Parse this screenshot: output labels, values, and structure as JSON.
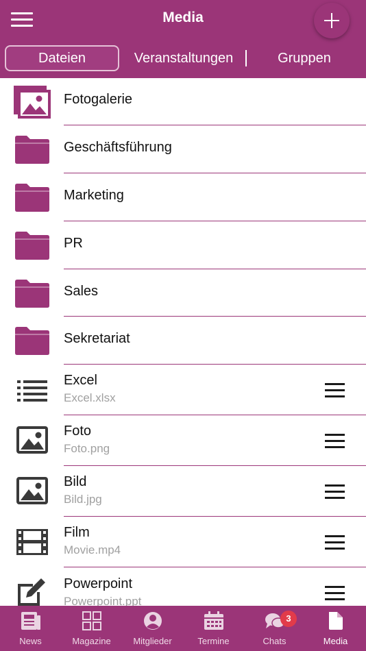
{
  "header": {
    "title": "Media"
  },
  "tabs": {
    "files": "Dateien",
    "events": "Veranstaltungen",
    "groups": "Gruppen"
  },
  "folders": [
    {
      "label": "Fotogalerie",
      "icon": "photo-gallery-icon"
    },
    {
      "label": "Geschäftsführung",
      "icon": "folder-icon"
    },
    {
      "label": "Marketing",
      "icon": "folder-icon"
    },
    {
      "label": "PR",
      "icon": "folder-icon"
    },
    {
      "label": "Sales",
      "icon": "folder-icon"
    },
    {
      "label": "Sekretariat",
      "icon": "folder-icon"
    }
  ],
  "files": [
    {
      "title": "Excel",
      "filename": "Excel.xlsx",
      "icon": "list-icon"
    },
    {
      "title": "Foto",
      "filename": "Foto.png",
      "icon": "image-icon"
    },
    {
      "title": "Bild",
      "filename": "Bild.jpg",
      "icon": "image-icon"
    },
    {
      "title": "Film",
      "filename": "Movie.mp4",
      "icon": "film-icon"
    },
    {
      "title": "Powerpoint",
      "filename": "Powerpoint.ppt",
      "icon": "edit-icon"
    }
  ],
  "nav": {
    "news": "News",
    "magazine": "Magazine",
    "members": "Mitglieder",
    "events": "Termine",
    "chats": "Chats",
    "media": "Media",
    "chats_badge": "3"
  },
  "colors": {
    "primary": "#9b3578",
    "badge": "#e23b4a",
    "icon_dark": "#3a3a3a"
  }
}
